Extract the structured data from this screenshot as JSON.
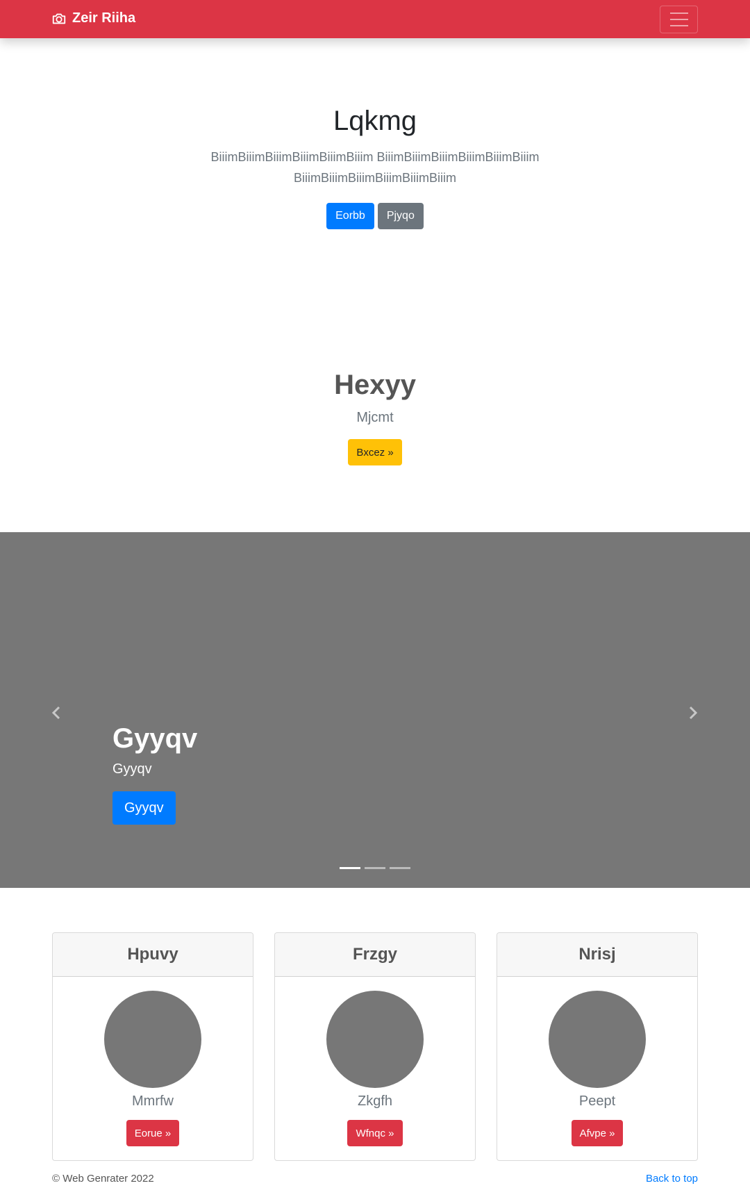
{
  "navbar": {
    "brand": "Zeir Riiha",
    "brand_icon": "camera-icon",
    "toggler_icon": "hamburger-menu-icon",
    "color": "#dc3545"
  },
  "hero": {
    "title": "Lqkmg",
    "lead": "BiiimBiiimBiiimBiiimBiiimBiiim BiiimBiiimBiiimBiiimBiiimBiiim BiiimBiiimBiiimBiiimBiiimBiiim",
    "primary_button": "Eorbb",
    "secondary_button": "Pjyqo"
  },
  "feature": {
    "title": "Hexyy",
    "subtitle": "Mjcmt",
    "button": "Bxcez »"
  },
  "carousel": {
    "slide_title": "Gyyqv",
    "slide_text": "Gyyqv",
    "slide_button": "Gyyqv",
    "prev_icon": "chevron-left-icon",
    "next_icon": "chevron-right-icon",
    "active_slide": 1,
    "slide_count": 3,
    "background": "#777777"
  },
  "cards": [
    {
      "header": "Hpuvy",
      "text": "Mmrfw",
      "button": "Eorue »"
    },
    {
      "header": "Frzgy",
      "text": "Zkgfh",
      "button": "Wfnqc »"
    },
    {
      "header": "Nrisj",
      "text": "Peept",
      "button": "Afvpe »"
    }
  ],
  "footer": {
    "copyright": "© Web Genrater 2022",
    "back_to_top": "Back to top"
  }
}
